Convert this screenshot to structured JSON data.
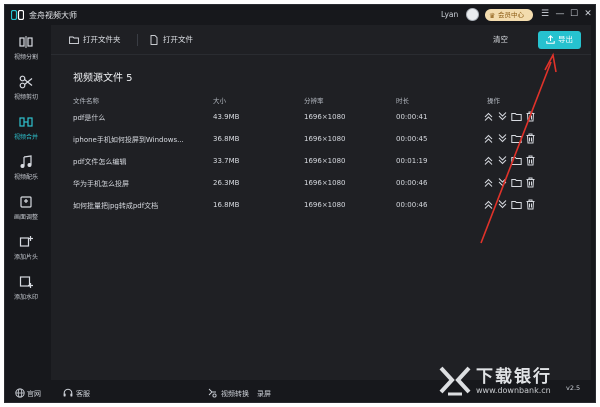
{
  "app": {
    "title": "金舟视频大师",
    "user_name": "Lyan",
    "vip_label": "会员中心"
  },
  "sidebar": {
    "items": [
      {
        "label": "视频分割",
        "icon": "split-icon",
        "active": false
      },
      {
        "label": "视频剪切",
        "icon": "scissors-icon",
        "active": false
      },
      {
        "label": "视频合并",
        "icon": "merge-icon",
        "active": true
      },
      {
        "label": "视频配乐",
        "icon": "music-icon",
        "active": false
      },
      {
        "label": "画面调整",
        "icon": "crop-icon",
        "active": false
      },
      {
        "label": "添加片头",
        "icon": "add-intro-icon",
        "active": false
      },
      {
        "label": "添加水印",
        "icon": "watermark-icon",
        "active": false
      }
    ]
  },
  "toolbar": {
    "open_folder": "打开文件夹",
    "open_file": "打开文件",
    "clear": "清空",
    "export": "导出"
  },
  "list": {
    "title": "视频源文件 5",
    "columns": {
      "name": "文件名称",
      "size": "大小",
      "resolution": "分辨率",
      "duration": "时长",
      "ops": "操作"
    },
    "rows": [
      {
        "name": "pdf是什么",
        "size": "43.9MB",
        "resolution": "1696×1080",
        "duration": "00:00:41"
      },
      {
        "name": "iphone手机如何投屏到Windows...",
        "size": "36.8MB",
        "resolution": "1696×1080",
        "duration": "00:00:45"
      },
      {
        "name": "pdf文件怎么编辑",
        "size": "33.7MB",
        "resolution": "1696×1080",
        "duration": "00:01:19"
      },
      {
        "name": "华为手机怎么投屏",
        "size": "26.3MB",
        "resolution": "1696×1080",
        "duration": "00:00:46"
      },
      {
        "name": "如何批量把jpg转成pdf文档",
        "size": "16.8MB",
        "resolution": "1696×1080",
        "duration": "00:00:46"
      }
    ]
  },
  "footer": {
    "website": "官网",
    "service": "客服",
    "convert": "视频转换",
    "record": "录屏",
    "version": "v2.5"
  },
  "watermark": {
    "text": "下载银行",
    "url": "www.downbank.cn"
  },
  "colors": {
    "accent": "#26c2cf",
    "vip_bg": "#f3dcae",
    "annotation": "#e0322a"
  }
}
